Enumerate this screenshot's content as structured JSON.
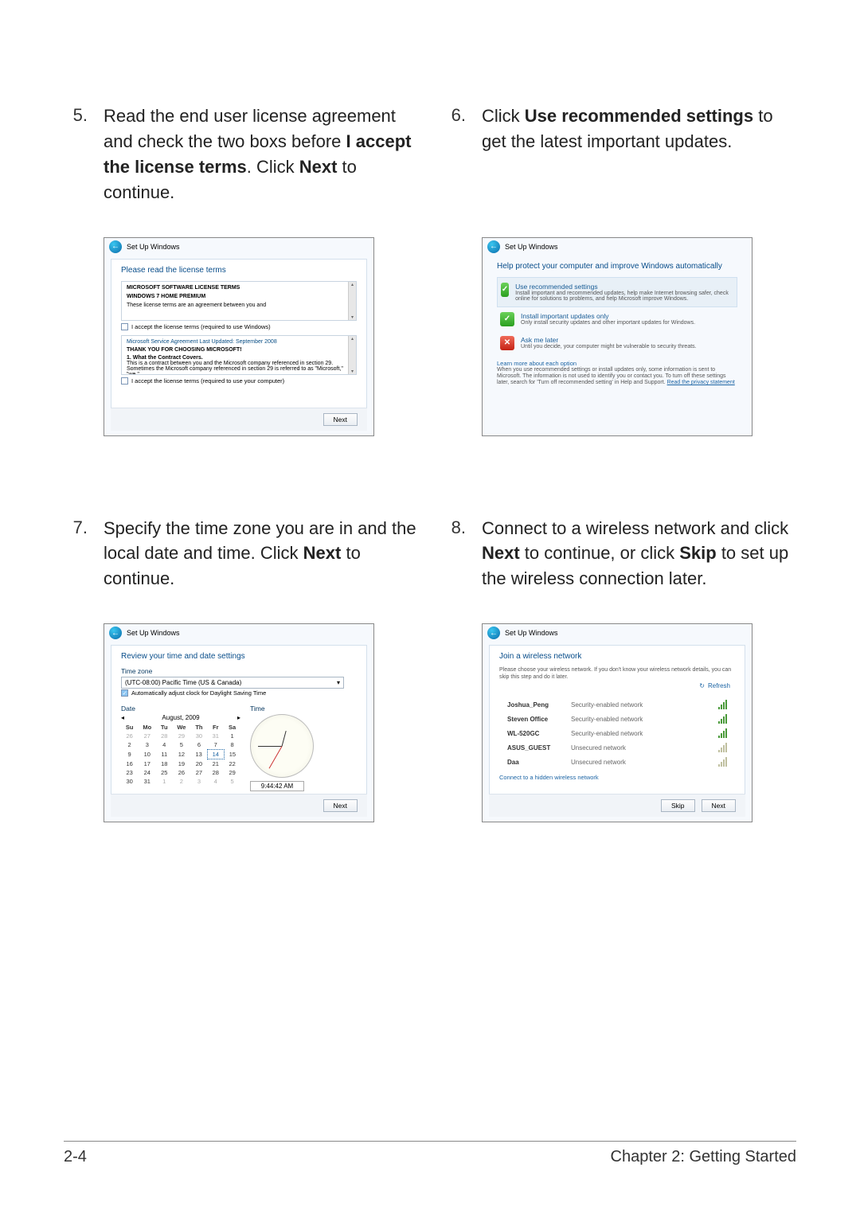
{
  "steps": {
    "s5": {
      "num": "5.",
      "text_a": "Read the end user license agreement and check the two boxs before ",
      "bold_a": "I accept the license terms",
      "text_b": ". Click ",
      "bold_b": "Next",
      "text_c": " to continue."
    },
    "s6": {
      "num": "6.",
      "text_a": "Click ",
      "bold_a": "Use recommended settings",
      "text_b": " to get the latest important updates."
    },
    "s7": {
      "num": "7.",
      "text_a": "Specify the time zone you are in and the local date and time. Click ",
      "bold_a": "Next",
      "text_b": " to continue."
    },
    "s8": {
      "num": "8.",
      "text_a": "Connect to a wireless network and click ",
      "bold_a": "Next",
      "text_b": " to continue, or click ",
      "bold_b": "Skip",
      "text_c": " to set up the wireless connection later."
    }
  },
  "win_title": "Set Up Windows",
  "license": {
    "heading": "Please read the license terms",
    "l1": "MICROSOFT SOFTWARE LICENSE TERMS",
    "l2": "WINDOWS 7 HOME PREMIUM",
    "l3": "These license terms are an agreement between you and",
    "chk1": "I accept the license terms (required to use Windows)",
    "l4": "Microsoft Service Agreement Last Updated: September 2008",
    "l5": "THANK YOU FOR CHOOSING MICROSOFT!",
    "l6": "1. What the Contract Covers.",
    "l7": "This is a contract between you and the Microsoft company referenced in section 29. Sometimes the Microsoft company referenced in section 29 is referred to as \"Microsoft,\" \"we,\"",
    "chk2": "I accept the license terms (required to use your computer)",
    "next": "Next"
  },
  "protect": {
    "heading": "Help protect your computer and improve Windows automatically",
    "opt1t": "Use recommended settings",
    "opt1s": "Install important and recommended updates, help make Internet browsing safer, check online for solutions to problems, and help Microsoft improve Windows.",
    "opt2t": "Install important updates only",
    "opt2s": "Only install security updates and other important updates for Windows.",
    "opt3t": "Ask me later",
    "opt3s": "Until you decide, your computer might be vulnerable to security threats.",
    "learn": "Learn more about each option",
    "foot": "When you use recommended settings or install updates only, some information is sent to Microsoft. The information is not used to identify you or contact you. To turn off these settings later, search for 'Turn off recommended setting' in Help and Support. ",
    "foot_link": "Read the privacy statement"
  },
  "timedate": {
    "heading": "Review your time and date settings",
    "tz_label": "Time zone",
    "tz_value": "(UTC-08:00) Pacific Time (US & Canada)",
    "dst": "Automatically adjust clock for Daylight Saving Time",
    "date_label": "Date",
    "time_label": "Time",
    "month": "August, 2009",
    "days": [
      "Su",
      "Mo",
      "Tu",
      "We",
      "Th",
      "Fr",
      "Sa"
    ],
    "weeks": [
      [
        "26",
        "27",
        "28",
        "29",
        "30",
        "31",
        "1"
      ],
      [
        "2",
        "3",
        "4",
        "5",
        "6",
        "7",
        "8"
      ],
      [
        "9",
        "10",
        "11",
        "12",
        "13",
        "14",
        "15"
      ],
      [
        "16",
        "17",
        "18",
        "19",
        "20",
        "21",
        "22"
      ],
      [
        "23",
        "24",
        "25",
        "26",
        "27",
        "28",
        "29"
      ],
      [
        "30",
        "31",
        "1",
        "2",
        "3",
        "4",
        "5"
      ]
    ],
    "selected_day": "14",
    "time_value": "9:44:42 AM",
    "next": "Next"
  },
  "wifi": {
    "heading": "Join a wireless network",
    "sub": "Please choose your wireless network. If you don't know your wireless network details, you can skip this step and do it later.",
    "refresh": "Refresh",
    "nets": [
      {
        "ssid": "Joshua_Peng",
        "sec": "Security-enabled network",
        "strong": true
      },
      {
        "ssid": "Steven Office",
        "sec": "Security-enabled network",
        "strong": true
      },
      {
        "ssid": "WL-520GC",
        "sec": "Security-enabled network",
        "strong": true
      },
      {
        "ssid": "ASUS_GUEST",
        "sec": "Unsecured network",
        "strong": false
      },
      {
        "ssid": "Daa",
        "sec": "Unsecured network",
        "strong": false
      }
    ],
    "hidden": "Connect to a hidden wireless network",
    "skip": "Skip",
    "next": "Next"
  },
  "footer": {
    "left": "2-4",
    "right": "Chapter 2: Getting Started"
  }
}
